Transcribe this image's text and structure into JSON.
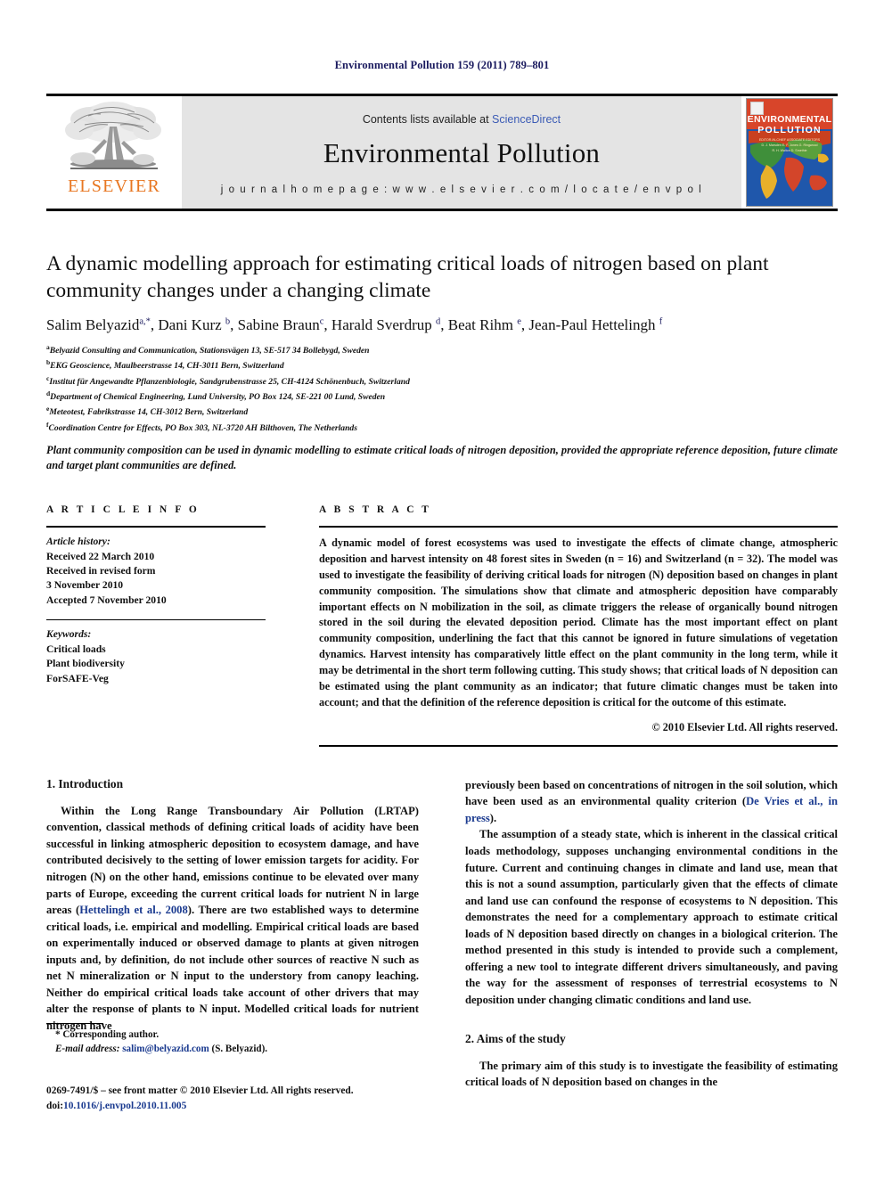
{
  "running_head": "Environmental Pollution 159 (2011) 789–801",
  "masthead": {
    "publisher_name": "ELSEVIER",
    "contents_prefix": "Contents lists available at ",
    "contents_link": "ScienceDirect",
    "journal_title": "Environmental Pollution",
    "homepage": "j o u r n a l   h o m e p a g e :   w w w . e l s e v i e r . c o m / l o c a t e / e n v p o l",
    "cover": {
      "line1": "ENVIRONMENTAL",
      "line2": "POLLUTION",
      "editors_line1": "EDITOR-IN-CHIEF      ASSOCIATE EDITORS",
      "editors_line2": "D. J. Marsden      E. F. Jones     G. Ringwood",
      "editors_line3": "R. H. Walton    D. Smethie",
      "colors": {
        "sky": "#1f57ab",
        "banner": "#d8452a",
        "land": "#e0a52b"
      }
    }
  },
  "article": {
    "title": "A dynamic modelling approach for estimating critical loads of nitrogen based on plant community changes under a changing climate",
    "authors": [
      {
        "name": "Salim Belyazid",
        "sup": "a,*"
      },
      {
        "name": "Dani Kurz",
        "sup": "b"
      },
      {
        "name": "Sabine Braun",
        "sup": "c"
      },
      {
        "name": "Harald Sverdrup",
        "sup": "d"
      },
      {
        "name": "Beat Rihm",
        "sup": "e"
      },
      {
        "name": "Jean-Paul Hettelingh",
        "sup": "f"
      }
    ],
    "affiliations": [
      {
        "mark": "a",
        "text": "Belyazid Consulting and Communication, Stationsvägen 13, SE-517 34 Bollebygd, Sweden"
      },
      {
        "mark": "b",
        "text": "EKG Geoscience, Maulbeerstrasse 14, CH-3011 Bern, Switzerland"
      },
      {
        "mark": "c",
        "text": "Institut für Angewandte Pflanzenbiologie, Sandgrubenstrasse 25, CH-4124 Schönenbuch, Switzerland"
      },
      {
        "mark": "d",
        "text": "Department of Chemical Engineering, Lund University, PO Box 124, SE-221 00 Lund, Sweden"
      },
      {
        "mark": "e",
        "text": "Meteotest, Fabrikstrasse 14, CH-3012 Bern, Switzerland"
      },
      {
        "mark": "f",
        "text": "Coordination Centre for Effects, PO Box 303, NL-3720 AH Bilthoven, The Netherlands"
      }
    ],
    "highlights": "Plant community composition can be used in dynamic modelling to estimate critical loads of nitrogen deposition, provided the appropriate reference deposition, future climate and target plant communities are defined."
  },
  "article_info": {
    "heading": "A R T I C L E   I N F O",
    "history_label": "Article history:",
    "history_lines": [
      "Received 22 March 2010",
      "Received in revised form",
      "3 November 2010",
      "Accepted 7 November 2010"
    ],
    "keywords_label": "Keywords:",
    "keywords": [
      "Critical loads",
      "Plant biodiversity",
      "ForSAFE-Veg"
    ]
  },
  "abstract": {
    "heading": "A B S T R A C T",
    "text": "A dynamic model of forest ecosystems was used to investigate the effects of climate change, atmospheric deposition and harvest intensity on 48 forest sites in Sweden (n = 16) and Switzerland (n = 32). The model was used to investigate the feasibility of deriving critical loads for nitrogen (N) deposition based on changes in plant community composition. The simulations show that climate and atmospheric deposition have comparably important effects on N mobilization in the soil, as climate triggers the release of organically bound nitrogen stored in the soil during the elevated deposition period. Climate has the most important effect on plant community composition, underlining the fact that this cannot be ignored in future simulations of vegetation dynamics. Harvest intensity has comparatively little effect on the plant community in the long term, while it may be detrimental in the short term following cutting. This study shows; that critical loads of N deposition can be estimated using the plant community as an indicator; that future climatic changes must be taken into account; and that the definition of the reference deposition is critical for the outcome of this estimate.",
    "copyright": "© 2010 Elsevier Ltd. All rights reserved."
  },
  "body": {
    "section1_heading": "1. Introduction",
    "section1_p1_a": "Within the Long Range Transboundary Air Pollution (LRTAP) convention, classical methods of defining critical loads of acidity have been successful in linking atmospheric deposition to ecosystem damage, and have contributed decisively to the setting of lower emission targets for acidity. For nitrogen (N) on the other hand, emissions continue to be elevated over many parts of Europe, exceeding the current critical loads for nutrient N in large areas (",
    "section1_p1_ref": "Hettelingh et al., 2008",
    "section1_p1_b": "). There are two established ways to determine critical loads, i.e. empirical and modelling. Empirical critical loads are based on experimentally induced or observed damage to plants at given nitrogen inputs and, by definition, do not include other sources of reactive N such as net N mineralization or N input to the understory from canopy leaching. Neither do empirical critical loads take account of other drivers that may alter the response of plants to N input. Modelled critical loads for nutrient nitrogen have",
    "section1_p1_c": "previously been based on concentrations of nitrogen in the soil solution, which have been used as an environmental quality criterion (",
    "section1_p1_ref2": "De Vries et al., in press",
    "section1_p1_d": ").",
    "section1_p2": "The assumption of a steady state, which is inherent in the classical critical loads methodology, supposes unchanging environmental conditions in the future. Current and continuing changes in climate and land use, mean that this is not a sound assumption, particularly given that the effects of climate and land use can confound the response of ecosystems to N deposition. This demonstrates the need for a complementary approach to estimate critical loads of N deposition based directly on changes in a biological criterion. The method presented in this study is intended to provide such a complement, offering a new tool to integrate different drivers simultaneously, and paving the way for the assessment of responses of terrestrial ecosystems to N deposition under changing climatic conditions and land use.",
    "section2_heading": "2. Aims of the study",
    "section2_p1": "The primary aim of this study is to investigate the feasibility of estimating critical loads of N deposition based on changes in the"
  },
  "footnotes": {
    "corresponding": "* Corresponding author.",
    "email_label": "E-mail address:",
    "email": "salim@belyazid.com",
    "email_suffix": "(S. Belyazid).",
    "imprint_line1": "0269-7491/$ – see front matter © 2010 Elsevier Ltd. All rights reserved.",
    "doi_label": "doi:",
    "doi": "10.1016/j.envpol.2010.11.005"
  }
}
